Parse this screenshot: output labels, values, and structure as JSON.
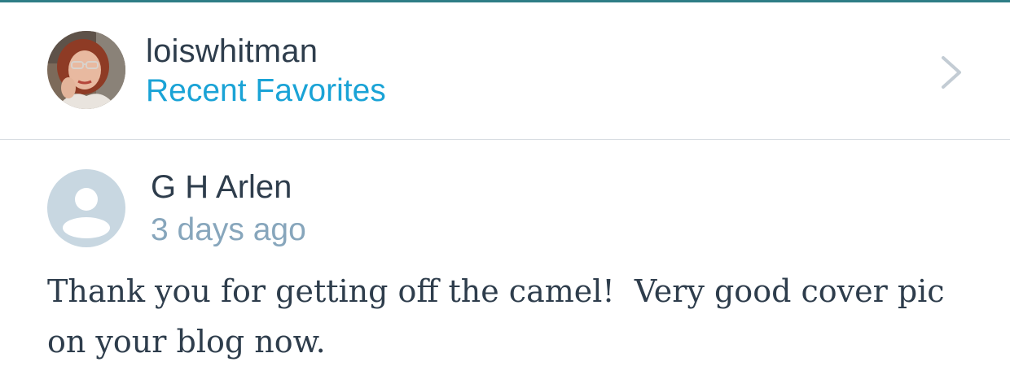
{
  "header": {
    "username": "loiswhitman",
    "subtitle": "Recent Favorites",
    "avatar_icon": "user-photo-avatar",
    "chevron_icon": "chevron-right-icon"
  },
  "comment": {
    "author": "G H Arlen",
    "timestamp": "3 days ago",
    "avatar_icon": "default-user-avatar-icon",
    "text": "Thank you for getting off the camel!  Very good cover pic on your blog now."
  },
  "colors": {
    "accent": "#1aa3d6",
    "primary_text": "#2e3d4c",
    "secondary_text": "#87a6bc",
    "default_avatar_bg": "#c8d7e1",
    "top_line": "#2e7d86"
  }
}
